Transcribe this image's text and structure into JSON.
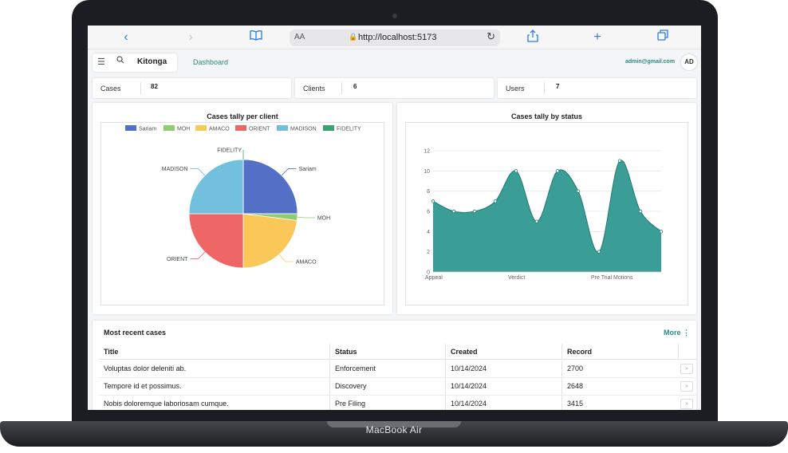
{
  "device": {
    "label": "MacBook Air"
  },
  "browser": {
    "text_size_label": "AA",
    "url": "http://localhost:5173",
    "icons": [
      "chevron-left-icon",
      "chevron-right-icon",
      "book-icon",
      "lock-icon",
      "reload-icon",
      "share-icon",
      "plus-icon",
      "tabs-icon"
    ]
  },
  "header": {
    "brand": "Kitonga",
    "nav_link": "Dashboard",
    "user_email": "admin@gmail.com",
    "avatar_initials": "AD"
  },
  "stats": [
    {
      "label": "Cases",
      "value": "82"
    },
    {
      "label": "Clients",
      "value": "6"
    },
    {
      "label": "Users",
      "value": "7"
    }
  ],
  "colors": {
    "accent": "#2a8a82",
    "area_fill": "#3a9e96",
    "area_stroke": "#217a73"
  },
  "chart_data": [
    {
      "type": "pie",
      "title": "Cases tally per client",
      "legend_position": "top",
      "slices": [
        {
          "name": "Sariam",
          "value": 25,
          "color": "#5470c6"
        },
        {
          "name": "MOH",
          "value": 2,
          "color": "#91cc75"
        },
        {
          "name": "AMACO",
          "value": 23,
          "color": "#fac858"
        },
        {
          "name": "ORIENT",
          "value": 25,
          "color": "#ee6666"
        },
        {
          "name": "MADISON",
          "value": 25,
          "color": "#73c0de"
        },
        {
          "name": "FIDELITY",
          "value": 0,
          "color": "#3ba272"
        }
      ]
    },
    {
      "type": "area",
      "title": "Cases tally by status",
      "grid": true,
      "ylim": [
        0,
        12
      ],
      "yticks": [
        0,
        2,
        4,
        6,
        8,
        10,
        12
      ],
      "x_tick_labels": [
        {
          "index": 0,
          "label": "Appeal"
        },
        {
          "index": 4,
          "label": "Verdict"
        },
        {
          "index": 8,
          "label": "Pre Trial Motions"
        }
      ],
      "values": [
        7,
        6,
        6,
        7,
        10,
        5,
        10,
        8,
        2,
        11,
        6,
        4
      ]
    }
  ],
  "recent_cases": {
    "title": "Most recent cases",
    "more_label": "More",
    "columns": [
      "Title",
      "Status",
      "Created",
      "Record"
    ],
    "rows": [
      {
        "title": "Voluptas dolor deleniti ab.",
        "status": "Enforcement",
        "created": "10/14/2024",
        "record": "2700"
      },
      {
        "title": "Tempore id et possimus.",
        "status": "Discovery",
        "created": "10/14/2024",
        "record": "2648"
      },
      {
        "title": "Nobis doloremque laboriosam cumque.",
        "status": "Pre Filing",
        "created": "10/14/2024",
        "record": "3415"
      }
    ]
  }
}
